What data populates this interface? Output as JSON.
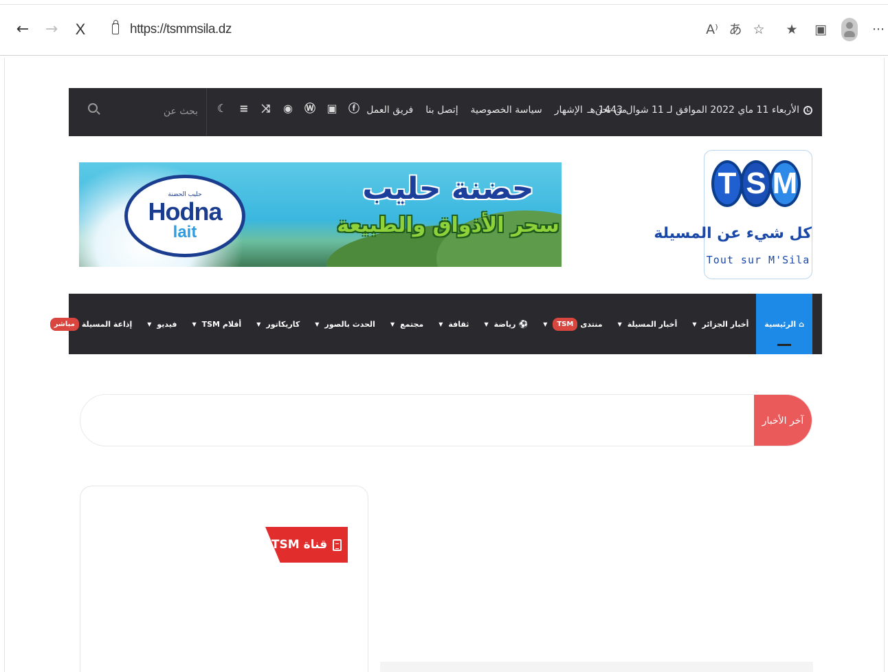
{
  "browser": {
    "back": "←",
    "forward": "→",
    "stop": "X",
    "url": "https://tsmmsila.dz",
    "tools": [
      "A⁾",
      "あ",
      "☆",
      "★",
      "▣"
    ],
    "more": "···"
  },
  "topbar": {
    "date": "الأربعاء 11 ماي 2022 الموافق لـ 11 شوال 1443 هـ",
    "links": [
      "من نحن",
      "الإشهار",
      "سياسة الخصوصية",
      "إتصل بنا",
      "فريق العمل"
    ],
    "search_placeholder": "بحث عن"
  },
  "logo": {
    "letters": [
      "T",
      "S",
      "M"
    ],
    "arabic": "كل شيء عن المسيلة",
    "french": "Tout sur M'Sila"
  },
  "banner": {
    "brand_top": "حليب الحضنة",
    "brand_main": "Hodna",
    "brand_sub": "lait",
    "title": "حضنة حليب",
    "subtitle": "سحر الأذواق والطبيعة"
  },
  "nav": {
    "items": [
      {
        "label": "الرئيسية",
        "active": true
      },
      {
        "label": "أخبار الجزائر",
        "caret": true
      },
      {
        "label": "أخبار المسيلة",
        "caret": true
      },
      {
        "label": "منتدى",
        "badge": "TSM",
        "caret": true
      },
      {
        "label": "رياضة",
        "caret": true
      },
      {
        "label": "ثقافة",
        "caret": true
      },
      {
        "label": "مجتمع",
        "caret": true
      },
      {
        "label": "الحدث بالصور",
        "caret": true
      },
      {
        "label": "كاريكاتور",
        "caret": true
      },
      {
        "label": "أقلام TSM",
        "caret": true
      },
      {
        "label": "فيديو",
        "caret": true
      },
      {
        "label": "إذاعة المسيلة",
        "badge": "مباشر",
        "caret": true
      }
    ],
    "caret_glyph": "▼"
  },
  "ticker": {
    "label": "آخر الأخبار"
  },
  "widget": {
    "title": "قناة TSM"
  },
  "colors": {
    "topbar_bg": "#2b2b2f",
    "nav_active": "#1c8ae6",
    "accent_red": "#e22d2d",
    "ticker_red": "#eb5a5a"
  }
}
